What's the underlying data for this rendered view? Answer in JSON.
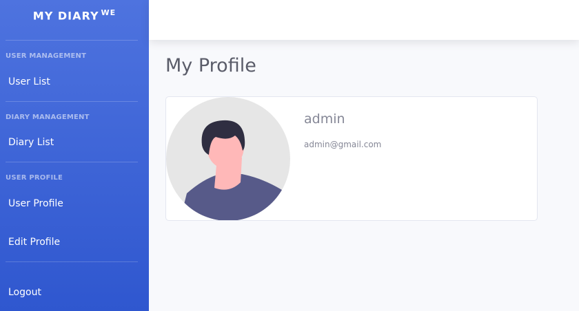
{
  "brand": {
    "title": "MY DIARY",
    "superscript": "WE"
  },
  "sidebar": {
    "sections": [
      {
        "heading": "USER MANAGEMENT",
        "items": [
          {
            "label": "User List"
          }
        ]
      },
      {
        "heading": "DIARY MANAGEMENT",
        "items": [
          {
            "label": "Diary List"
          }
        ]
      },
      {
        "heading": "USER PROFILE",
        "items": [
          {
            "label": "User Profile"
          },
          {
            "label": "Edit Profile"
          }
        ]
      }
    ],
    "logout_label": "Logout"
  },
  "main": {
    "title": "My Profile",
    "profile": {
      "avatar_icon": "user-avatar-illustration",
      "name": "admin",
      "email": "admin@gmail.com"
    }
  },
  "colors": {
    "sidebar_gradient_top": "#4e73df",
    "sidebar_gradient_bottom": "#2f57cf",
    "page_background": "#f8f9fc",
    "text_gray": "#858796"
  }
}
